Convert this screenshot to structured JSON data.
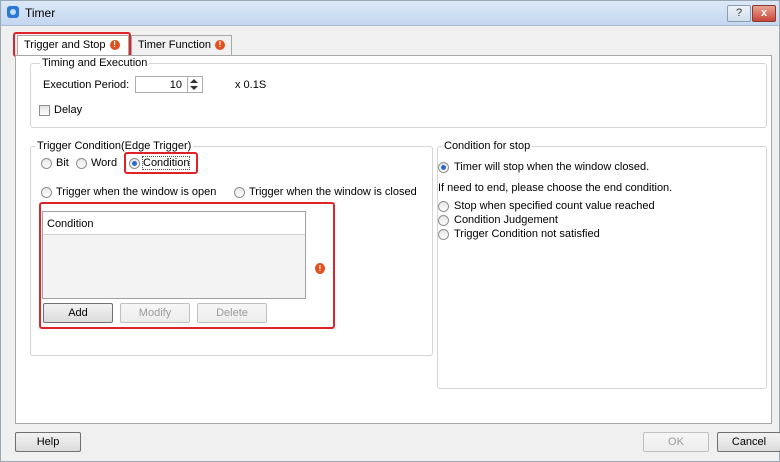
{
  "window": {
    "title": "Timer",
    "help_glyph": "?",
    "close_glyph": "x"
  },
  "tabs": [
    {
      "label": "Trigger and Stop",
      "warn": "!"
    },
    {
      "label": "Timer Function",
      "warn": "!"
    }
  ],
  "timing": {
    "group_title": "Timing and Execution",
    "period_label": "Execution Period:",
    "period_value": "10",
    "unit": "x 0.1S",
    "delay_label": "Delay"
  },
  "trigger": {
    "group_title": "Trigger Condition(Edge Trigger)",
    "types": [
      "Bit",
      "Word",
      "Condition"
    ],
    "selected_type": "Condition",
    "when_open": "Trigger when the window is open",
    "when_closed": "Trigger when the window is closed",
    "grid_header": "Condition",
    "warn": "!",
    "buttons": {
      "add": "Add",
      "modify": "Modify",
      "delete": "Delete"
    }
  },
  "stop": {
    "group_title": "Condition for stop",
    "selected": "Timer will stop when the window closed.",
    "hint": "If need to end, please choose the end condition.",
    "options": [
      "Stop when specified count value reached",
      "Condition Judgement",
      "Trigger Condition not satisfied"
    ]
  },
  "footer": {
    "help": "Help",
    "ok": "OK",
    "cancel": "Cancel"
  },
  "colors": {
    "highlight": "#e0232a",
    "radio_selected": "#2a69c4",
    "warning": "#e05020"
  }
}
